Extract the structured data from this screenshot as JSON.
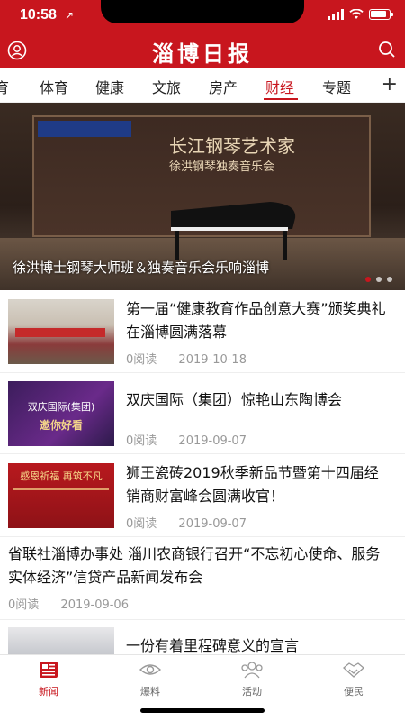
{
  "statusbar": {
    "time": "10:58",
    "location_arrow": "↗"
  },
  "app": {
    "title": "淄博日报"
  },
  "tabs": [
    {
      "label": "育"
    },
    {
      "label": "体育"
    },
    {
      "label": "健康"
    },
    {
      "label": "文旅"
    },
    {
      "label": "房产"
    },
    {
      "label": "财经",
      "active": true
    },
    {
      "label": "专题"
    }
  ],
  "add_tab_icon": "+",
  "banner": {
    "caption": "徐洪博士钢琴大师班＆独奏音乐会乐响淄博",
    "stage_title": "长江钢琴艺术家",
    "stage_subtitle": "徐洪钢琴独奏音乐会",
    "slides": 3,
    "active_slide": 0
  },
  "news": [
    {
      "title": "第一届“健康教育作品创意大赛”颁奖典礼在淄博圆满落幕",
      "reads": "0阅读",
      "date": "2019-10-18",
      "has_image": true
    },
    {
      "title": "双庆国际（集团）惊艳山东陶博会",
      "reads": "0阅读",
      "date": "2019-09-07",
      "has_image": true,
      "thumb_text": "双庆国际(集团)",
      "thumb_text2": "邀你好看"
    },
    {
      "title": "狮王瓷砖2019秋季新品节暨第十四届经销商财富峰会圆满收官！",
      "reads": "0阅读",
      "date": "2019-09-07",
      "has_image": true,
      "thumb_text": "感恩祈福 再筑不凡"
    },
    {
      "title": "省联社淄博办事处 淄川农商银行召开“不忘初心使命、服务实体经济”信贷产品新闻发布会",
      "reads": "0阅读",
      "date": "2019-09-06",
      "has_image": false
    },
    {
      "title": "一份有着里程碑意义的宣言",
      "has_image": true
    }
  ],
  "bottom_nav": [
    {
      "label": "新闻",
      "icon": "news-icon",
      "active": true
    },
    {
      "label": "爆料",
      "icon": "eye-icon"
    },
    {
      "label": "活动",
      "icon": "people-icon"
    },
    {
      "label": "便民",
      "icon": "handshake-icon"
    }
  ],
  "colors": {
    "brand": "#c8161e",
    "meta": "#999999"
  }
}
